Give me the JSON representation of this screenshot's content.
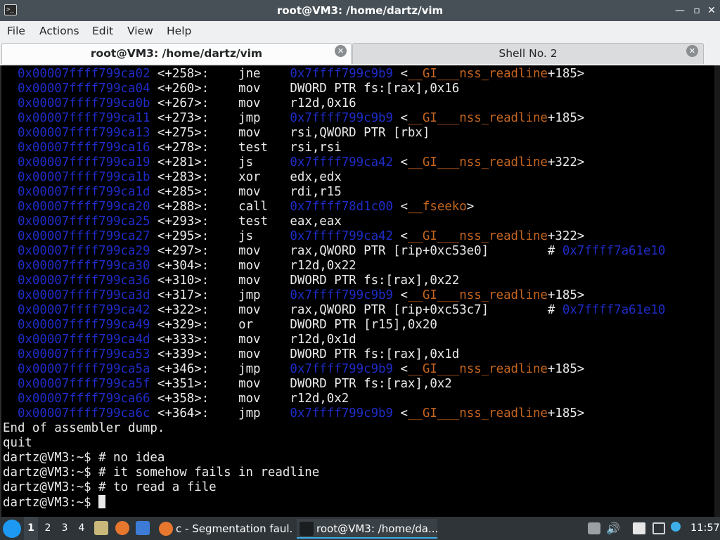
{
  "window": {
    "title": "root@VM3: /home/dartz/vim",
    "controls": {
      "minimize": "—",
      "maximize": "▫",
      "close": "✕"
    }
  },
  "menubar": {
    "items": [
      "File",
      "Actions",
      "Edit",
      "View",
      "Help"
    ]
  },
  "tabs": [
    {
      "label": "root@VM3: /home/dartz/vim",
      "active": true
    },
    {
      "label": "Shell No. 2",
      "active": false
    }
  ],
  "terminal": {
    "asm": [
      {
        "addr": "0x00007ffff799ca02",
        "off": "<+258>:",
        "op": "jne",
        "plain": "",
        "target": "0x7ffff799c9b9",
        "sym_pre": "<",
        "sym": "__GI___nss_readline",
        "sym_post": "+185>",
        "comment_hash": "",
        "comment_addr": ""
      },
      {
        "addr": "0x00007ffff799ca04",
        "off": "<+260>:",
        "op": "mov",
        "plain": "DWORD PTR fs:[rax],0x16",
        "target": "",
        "sym_pre": "",
        "sym": "",
        "sym_post": "",
        "comment_hash": "",
        "comment_addr": ""
      },
      {
        "addr": "0x00007ffff799ca0b",
        "off": "<+267>:",
        "op": "mov",
        "plain": "r12d,0x16",
        "target": "",
        "sym_pre": "",
        "sym": "",
        "sym_post": "",
        "comment_hash": "",
        "comment_addr": ""
      },
      {
        "addr": "0x00007ffff799ca11",
        "off": "<+273>:",
        "op": "jmp",
        "plain": "",
        "target": "0x7ffff799c9b9",
        "sym_pre": "<",
        "sym": "__GI___nss_readline",
        "sym_post": "+185>",
        "comment_hash": "",
        "comment_addr": ""
      },
      {
        "addr": "0x00007ffff799ca13",
        "off": "<+275>:",
        "op": "mov",
        "plain": "rsi,QWORD PTR [rbx]",
        "target": "",
        "sym_pre": "",
        "sym": "",
        "sym_post": "",
        "comment_hash": "",
        "comment_addr": ""
      },
      {
        "addr": "0x00007ffff799ca16",
        "off": "<+278>:",
        "op": "test",
        "plain": "rsi,rsi",
        "target": "",
        "sym_pre": "",
        "sym": "",
        "sym_post": "",
        "comment_hash": "",
        "comment_addr": ""
      },
      {
        "addr": "0x00007ffff799ca19",
        "off": "<+281>:",
        "op": "js",
        "plain": "",
        "target": "0x7ffff799ca42",
        "sym_pre": "<",
        "sym": "__GI___nss_readline",
        "sym_post": "+322>",
        "comment_hash": "",
        "comment_addr": ""
      },
      {
        "addr": "0x00007ffff799ca1b",
        "off": "<+283>:",
        "op": "xor",
        "plain": "edx,edx",
        "target": "",
        "sym_pre": "",
        "sym": "",
        "sym_post": "",
        "comment_hash": "",
        "comment_addr": ""
      },
      {
        "addr": "0x00007ffff799ca1d",
        "off": "<+285>:",
        "op": "mov",
        "plain": "rdi,r15",
        "target": "",
        "sym_pre": "",
        "sym": "",
        "sym_post": "",
        "comment_hash": "",
        "comment_addr": ""
      },
      {
        "addr": "0x00007ffff799ca20",
        "off": "<+288>:",
        "op": "call",
        "plain": "",
        "target": "0x7ffff78d1c00",
        "sym_pre": "<",
        "sym": "__fseeko",
        "sym_post": ">",
        "comment_hash": "",
        "comment_addr": ""
      },
      {
        "addr": "0x00007ffff799ca25",
        "off": "<+293>:",
        "op": "test",
        "plain": "eax,eax",
        "target": "",
        "sym_pre": "",
        "sym": "",
        "sym_post": "",
        "comment_hash": "",
        "comment_addr": ""
      },
      {
        "addr": "0x00007ffff799ca27",
        "off": "<+295>:",
        "op": "js",
        "plain": "",
        "target": "0x7ffff799ca42",
        "sym_pre": "<",
        "sym": "__GI___nss_readline",
        "sym_post": "+322>",
        "comment_hash": "",
        "comment_addr": ""
      },
      {
        "addr": "0x00007ffff799ca29",
        "off": "<+297>:",
        "op": "mov",
        "plain": "rax,QWORD PTR [rip+0xc53e0]        ",
        "target": "",
        "sym_pre": "",
        "sym": "",
        "sym_post": "",
        "comment_hash": "# ",
        "comment_addr": "0x7ffff7a61e10"
      },
      {
        "addr": "0x00007ffff799ca30",
        "off": "<+304>:",
        "op": "mov",
        "plain": "r12d,0x22",
        "target": "",
        "sym_pre": "",
        "sym": "",
        "sym_post": "",
        "comment_hash": "",
        "comment_addr": ""
      },
      {
        "addr": "0x00007ffff799ca36",
        "off": "<+310>:",
        "op": "mov",
        "plain": "DWORD PTR fs:[rax],0x22",
        "target": "",
        "sym_pre": "",
        "sym": "",
        "sym_post": "",
        "comment_hash": "",
        "comment_addr": ""
      },
      {
        "addr": "0x00007ffff799ca3d",
        "off": "<+317>:",
        "op": "jmp",
        "plain": "",
        "target": "0x7ffff799c9b9",
        "sym_pre": "<",
        "sym": "__GI___nss_readline",
        "sym_post": "+185>",
        "comment_hash": "",
        "comment_addr": ""
      },
      {
        "addr": "0x00007ffff799ca42",
        "off": "<+322>:",
        "op": "mov",
        "plain": "rax,QWORD PTR [rip+0xc53c7]        ",
        "target": "",
        "sym_pre": "",
        "sym": "",
        "sym_post": "",
        "comment_hash": "# ",
        "comment_addr": "0x7ffff7a61e10"
      },
      {
        "addr": "0x00007ffff799ca49",
        "off": "<+329>:",
        "op": "or",
        "plain": "DWORD PTR [r15],0x20",
        "target": "",
        "sym_pre": "",
        "sym": "",
        "sym_post": "",
        "comment_hash": "",
        "comment_addr": ""
      },
      {
        "addr": "0x00007ffff799ca4d",
        "off": "<+333>:",
        "op": "mov",
        "plain": "r12d,0x1d",
        "target": "",
        "sym_pre": "",
        "sym": "",
        "sym_post": "",
        "comment_hash": "",
        "comment_addr": ""
      },
      {
        "addr": "0x00007ffff799ca53",
        "off": "<+339>:",
        "op": "mov",
        "plain": "DWORD PTR fs:[rax],0x1d",
        "target": "",
        "sym_pre": "",
        "sym": "",
        "sym_post": "",
        "comment_hash": "",
        "comment_addr": ""
      },
      {
        "addr": "0x00007ffff799ca5a",
        "off": "<+346>:",
        "op": "jmp",
        "plain": "",
        "target": "0x7ffff799c9b9",
        "sym_pre": "<",
        "sym": "__GI___nss_readline",
        "sym_post": "+185>",
        "comment_hash": "",
        "comment_addr": ""
      },
      {
        "addr": "0x00007ffff799ca5f",
        "off": "<+351>:",
        "op": "mov",
        "plain": "DWORD PTR fs:[rax],0x2",
        "target": "",
        "sym_pre": "",
        "sym": "",
        "sym_post": "",
        "comment_hash": "",
        "comment_addr": ""
      },
      {
        "addr": "0x00007ffff799ca66",
        "off": "<+358>:",
        "op": "mov",
        "plain": "r12d,0x2",
        "target": "",
        "sym_pre": "",
        "sym": "",
        "sym_post": "",
        "comment_hash": "",
        "comment_addr": ""
      },
      {
        "addr": "0x00007ffff799ca6c",
        "off": "<+364>:",
        "op": "jmp",
        "plain": "",
        "target": "0x7ffff799c9b9",
        "sym_pre": "<",
        "sym": "__GI___nss_readline",
        "sym_post": "+185>",
        "comment_hash": "",
        "comment_addr": ""
      }
    ],
    "plain_lines": [
      "End of assembler dump.",
      "quit",
      "dartz@VM3:~$ # no idea",
      "dartz@VM3:~$ # it somehow fails in readline",
      "dartz@VM3:~$ # to read a file"
    ],
    "prompt": "dartz@VM3:~$ ",
    "colors": {
      "background": "#000000",
      "text": "#eaeaea",
      "address": "#1e2cc8",
      "symbol": "#c5651f"
    }
  },
  "taskbar": {
    "desktops": [
      "1",
      "2",
      "3",
      "4"
    ],
    "active_desktop": "1",
    "tasks": [
      {
        "label": "c - Segmentation faul...",
        "icon": "firefox-icon",
        "active": false
      },
      {
        "label": "root@VM3: /home/da...",
        "icon": "terminal-icon",
        "active": true
      }
    ],
    "clock": "11:57"
  }
}
